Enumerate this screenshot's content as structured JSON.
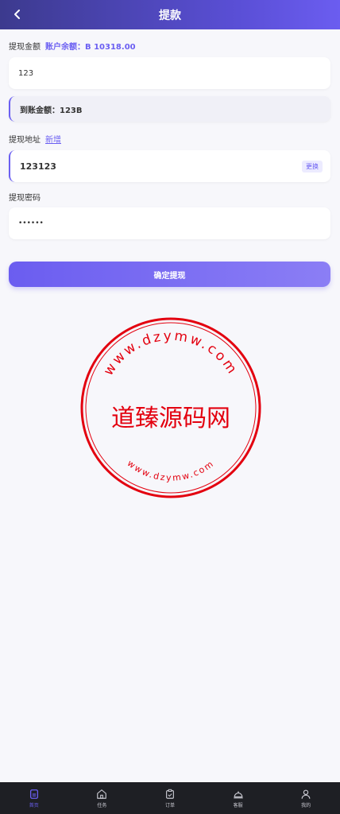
{
  "header": {
    "title": "提款"
  },
  "amount": {
    "label": "提现金额",
    "balance_label": "账户余额：",
    "balance_value": "B 10318.00",
    "value": "123"
  },
  "arrival": {
    "text": "到账金额：123B"
  },
  "address": {
    "label": "提现地址",
    "add_link": "新增",
    "value": "123123",
    "change_button": "更换"
  },
  "password": {
    "label": "提现密码",
    "value": "••••••"
  },
  "submit_label": "确定提现",
  "watermark": {
    "center_text": "道臻源码网",
    "top_arc": "www.dzymw.com",
    "bottom_arc": "www.dzymw.com",
    "color": "#e3000f"
  },
  "tabbar": {
    "active_color": "#6b5ff2",
    "items": [
      {
        "label": "首页",
        "icon": "file-icon"
      },
      {
        "label": "任务",
        "icon": "home-icon"
      },
      {
        "label": "订单",
        "icon": "clipboard-check-icon"
      },
      {
        "label": "客服",
        "icon": "service-bell-icon"
      },
      {
        "label": "我的",
        "icon": "user-icon"
      }
    ]
  }
}
